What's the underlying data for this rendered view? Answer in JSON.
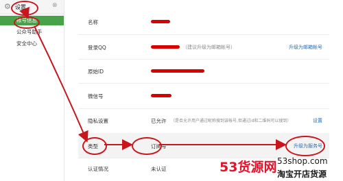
{
  "sidebar": {
    "title": "设置",
    "items": [
      {
        "label": "帐号信息",
        "active": true
      },
      {
        "label": "公众号助手",
        "active": false
      },
      {
        "label": "安全中心",
        "active": false
      }
    ]
  },
  "rows": [
    {
      "label": "名称",
      "value": "",
      "hint": "",
      "action": ""
    },
    {
      "label": "登录QQ",
      "value": "",
      "hint": "（建议升级为邮箱帐号）",
      "action": "升级为邮箱帐号"
    },
    {
      "label": "原始ID",
      "value": "",
      "hint": "",
      "action": ""
    },
    {
      "label": "微信号",
      "value": "",
      "hint": "",
      "action": ""
    },
    {
      "label": "隐私设置",
      "value": "已允许",
      "hint": "（是否允许用户通过昵称搜到该帐号,但通过id和二维码可以搜到）",
      "action": "设置"
    },
    {
      "label": "类型",
      "value": "订阅号",
      "hint": "",
      "action": "升级为服务号"
    },
    {
      "label": "认证情况",
      "value": "未认证",
      "hint": "",
      "action": ""
    }
  ],
  "watermark": {
    "number": "53货源网",
    "site": "53shop.com",
    "slogan": "淘宝开店货源"
  },
  "colors": {
    "accent": "#48a24a",
    "annotation": "#c9161d",
    "link": "#2a6fb6",
    "redaction": "#d90000"
  }
}
